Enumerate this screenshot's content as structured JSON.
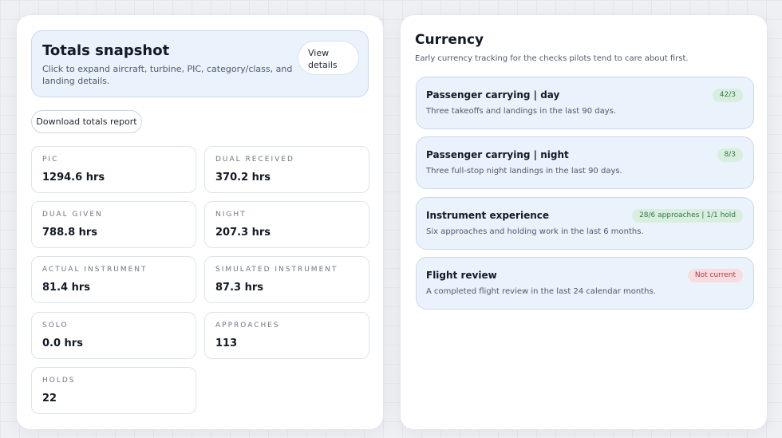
{
  "totals": {
    "title": "Totals snapshot",
    "description": "Click to expand aircraft, turbine, PIC, category/class, and landing details.",
    "view_details_label": "View details",
    "download_label": "Download totals report",
    "stats": [
      {
        "label": "PIC",
        "value": "1294.6 hrs"
      },
      {
        "label": "DUAL RECEIVED",
        "value": "370.2 hrs"
      },
      {
        "label": "DUAL GIVEN",
        "value": "788.8 hrs"
      },
      {
        "label": "NIGHT",
        "value": "207.3 hrs"
      },
      {
        "label": "ACTUAL INSTRUMENT",
        "value": "81.4 hrs"
      },
      {
        "label": "SIMULATED INSTRUMENT",
        "value": "87.3 hrs"
      },
      {
        "label": "SOLO",
        "value": "0.0 hrs"
      },
      {
        "label": "APPROACHES",
        "value": "113"
      },
      {
        "label": "HOLDS",
        "value": "22"
      }
    ]
  },
  "currency": {
    "title": "Currency",
    "subtitle": "Early currency tracking for the checks pilots tend to care about first.",
    "items": [
      {
        "title": "Passenger carrying | day",
        "description": "Three takeoffs and landings in the last 90 days.",
        "badge": "42/3",
        "status": "current"
      },
      {
        "title": "Passenger carrying | night",
        "description": "Three full-stop night landings in the last 90 days.",
        "badge": "8/3",
        "status": "current"
      },
      {
        "title": "Instrument experience",
        "description": "Six approaches and holding work in the last 6 months.",
        "badge": "28/6 approaches | 1/1 hold",
        "status": "current"
      },
      {
        "title": "Flight review",
        "description": "A completed flight review in the last 24 calendar months.",
        "badge": "Not current",
        "status": "not-current"
      }
    ]
  },
  "colors": {
    "card_bg": "#eaf2fb",
    "badge_ok_bg": "#d9eedf",
    "badge_ok_text": "#2f7a48",
    "badge_bad_bg": "#f8dde0",
    "badge_bad_text": "#b33a47"
  }
}
